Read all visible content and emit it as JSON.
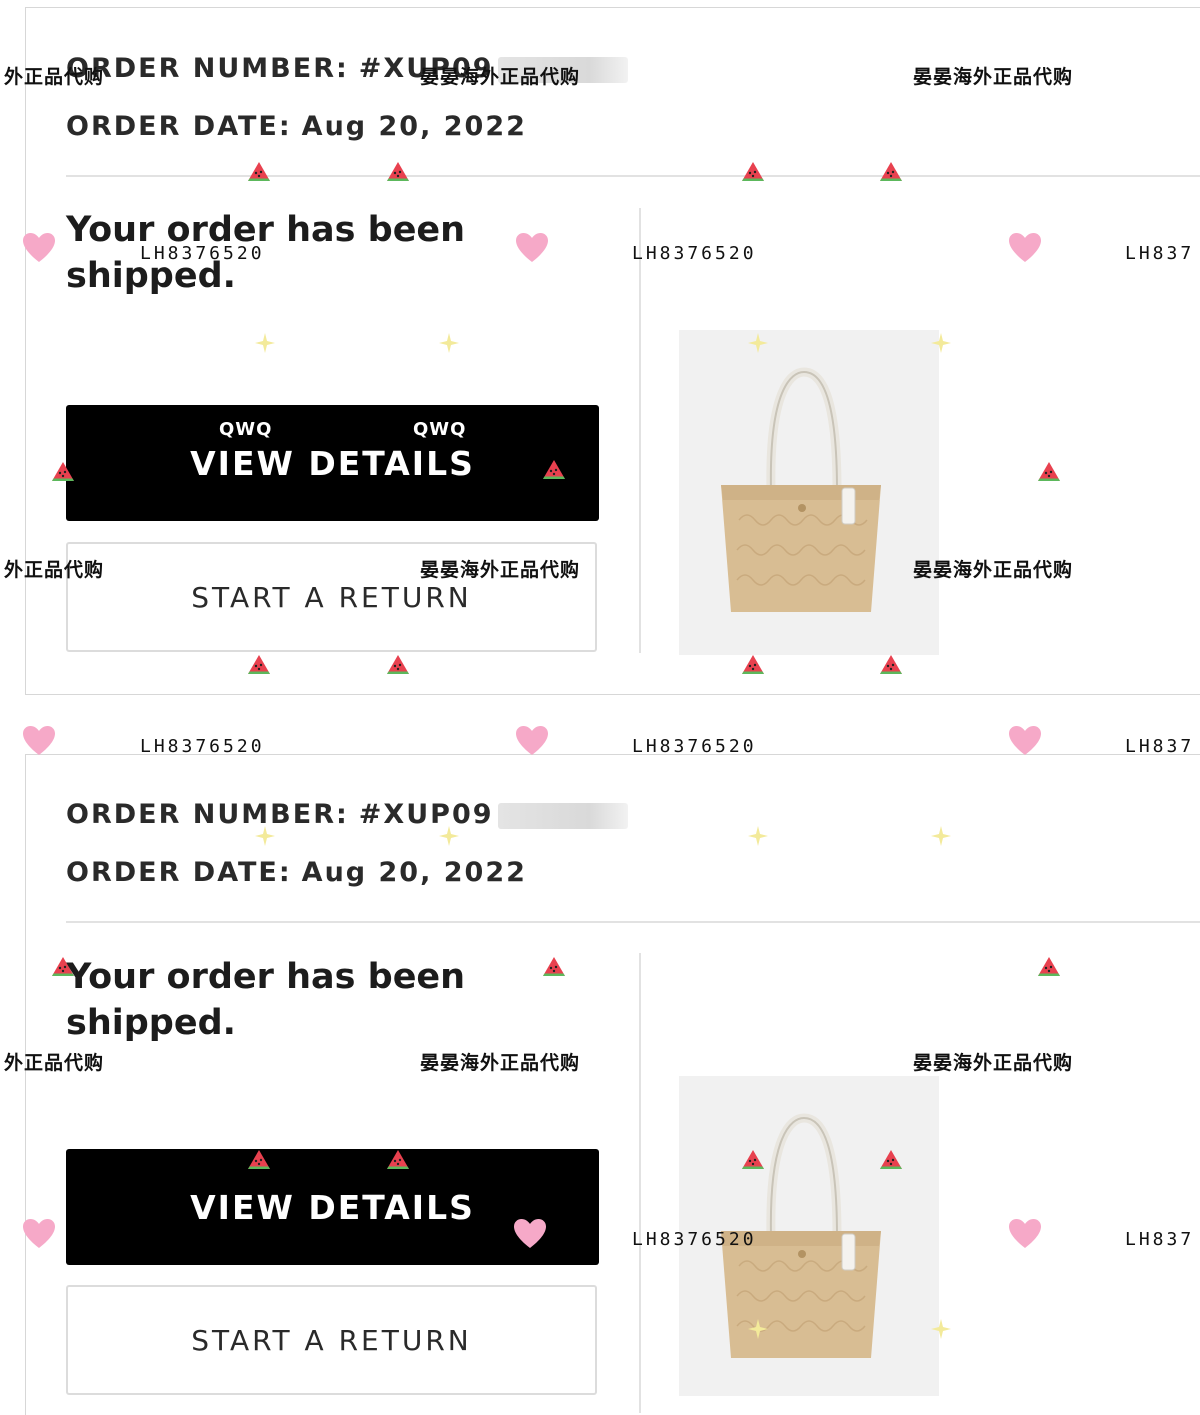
{
  "orders": [
    {
      "order_number_label": "ORDER NUMBER:",
      "order_number": "#XUP09",
      "order_date_label": "ORDER DATE:",
      "order_date": "Aug 20, 2022",
      "status": "Your order has been shipped.",
      "view_details_label": "VIEW DETAILS",
      "start_return_label": "START A RETURN"
    },
    {
      "order_number_label": "ORDER NUMBER:",
      "order_number": "#XUP09",
      "order_date_label": "ORDER DATE:",
      "order_date": "Aug 20, 2022",
      "status": "Your order has been shipped.",
      "view_details_label": "VIEW DETAILS",
      "start_return_label": "START A RETURN"
    }
  ],
  "watermarks": {
    "shop_full": "晏晏海外正品代购",
    "shop_short": "外正品代购",
    "code": "LH8376520",
    "code_cut": "LH837",
    "qwq": "QWQ"
  },
  "colors": {
    "primary_button": "#000000",
    "card_border": "#d7d7d7",
    "watermelon": "#e8414f",
    "heart": "#f6a9c8"
  },
  "icons": [
    "watermelon-icon",
    "heart-icon",
    "sparkle-icon",
    "tote-bag-image"
  ]
}
